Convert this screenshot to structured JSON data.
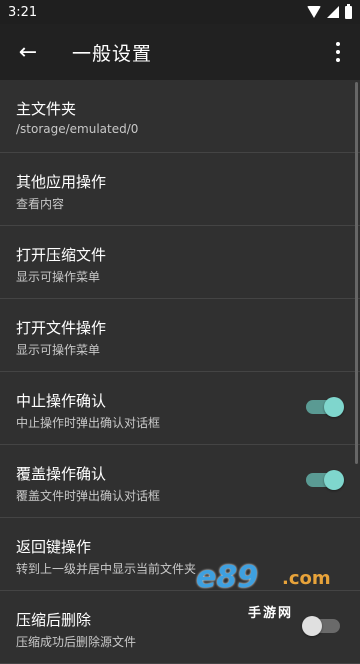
{
  "status_bar": {
    "time": "3:21"
  },
  "app_bar": {
    "title": "一般设置"
  },
  "settings": [
    {
      "title": "主文件夹",
      "subtitle": "/storage/emulated/0"
    },
    {
      "title": "其他应用操作",
      "subtitle": "查看内容"
    },
    {
      "title": "打开压缩文件",
      "subtitle": "显示可操作菜单"
    },
    {
      "title": "打开文件操作",
      "subtitle": "显示可操作菜单"
    },
    {
      "title": "中止操作确认",
      "subtitle": "中止操作时弹出确认对话框",
      "toggle_on": true
    },
    {
      "title": "覆盖操作确认",
      "subtitle": "覆盖文件时弹出确认对话框",
      "toggle_on": true
    },
    {
      "title": "返回键操作",
      "subtitle": "转到上一级并居中显示当前文件夹"
    },
    {
      "title": "压缩后删除",
      "subtitle": "压缩成功后删除源文件",
      "toggle_on": false
    }
  ],
  "watermark": {
    "logo": "e89",
    "domain": ".com",
    "name": "手游网"
  },
  "colors": {
    "accent": "#7fd6cd",
    "background": "#303030",
    "app_bar": "#212121"
  }
}
